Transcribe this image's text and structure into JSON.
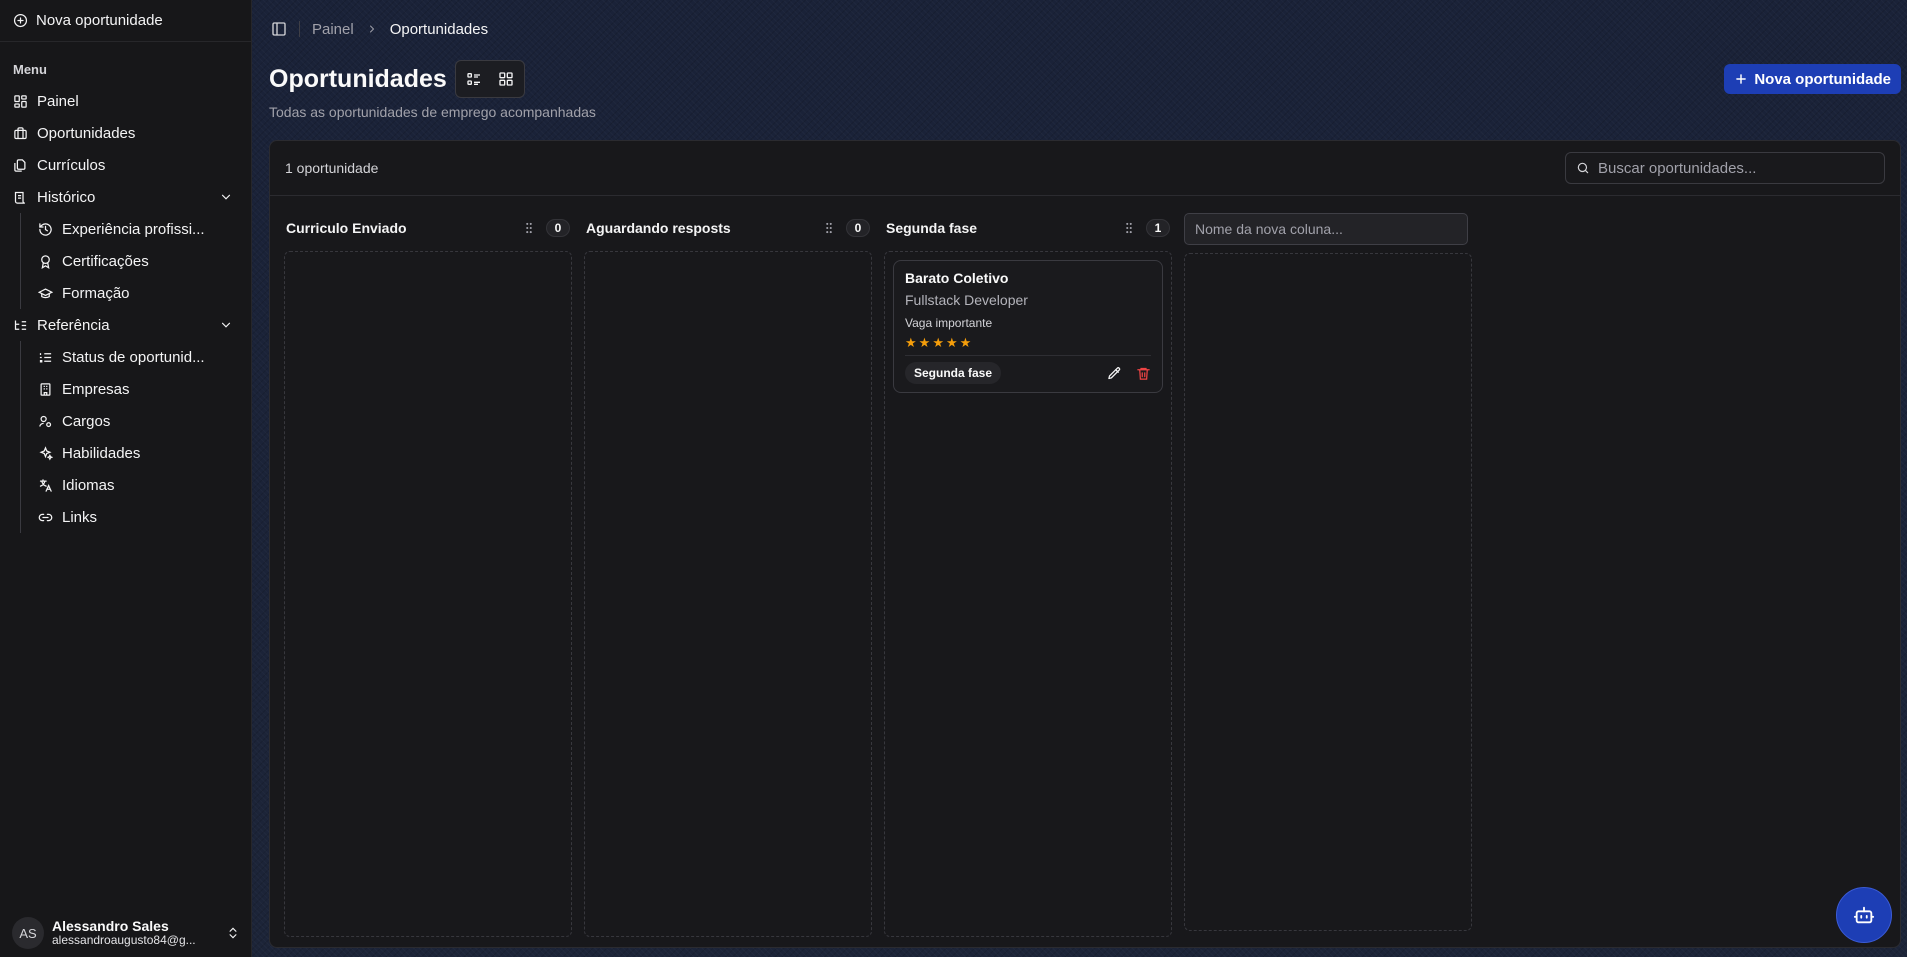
{
  "sidebar": {
    "new_opportunity_label": "Nova oportunidade",
    "menu_label": "Menu",
    "items": {
      "panel": "Painel",
      "opportunities": "Oportunidades",
      "resumes": "Currículos",
      "history": "Histórico",
      "reference": "Referência"
    },
    "history_items": [
      "Experiência profissi...",
      "Certificações",
      "Formação"
    ],
    "reference_items": [
      "Status de oportunid...",
      "Empresas",
      "Cargos",
      "Habilidades",
      "Idiomas",
      "Links"
    ],
    "user": {
      "initials": "AS",
      "name": "Alessandro Sales",
      "email": "alessandroaugusto84@g..."
    }
  },
  "breadcrumb": {
    "parent": "Painel",
    "current": "Oportunidades"
  },
  "page": {
    "title": "Oportunidades",
    "subtitle": "Todas as oportunidades de emprego acompanhadas",
    "primary_button": "Nova oportunidade"
  },
  "board": {
    "count_text": "1 oportunidade",
    "search_placeholder": "Buscar oportunidades...",
    "new_column_placeholder": "Nome da nova coluna...",
    "columns": [
      {
        "title": "Curriculo Enviado",
        "count": "0"
      },
      {
        "title": "Aguardando resposts",
        "count": "0"
      },
      {
        "title": "Segunda fase",
        "count": "1"
      }
    ],
    "card": {
      "company": "Barato Coletivo",
      "role": "Fullstack Developer",
      "note": "Vaga importante",
      "rating": 5,
      "status": "Segunda fase"
    }
  },
  "colors": {
    "accent": "#1d3eb5",
    "star": "#f59e0b",
    "danger": "#ef4444"
  },
  "icons": {
    "sidebar_toggle": "panel-left-icon",
    "list_view": "list-icon",
    "grid_view": "grid-icon",
    "search": "search-icon",
    "drag": "grip-vertical-icon",
    "edit": "pencil-icon",
    "delete": "trash-icon",
    "assistant": "bot-icon"
  }
}
